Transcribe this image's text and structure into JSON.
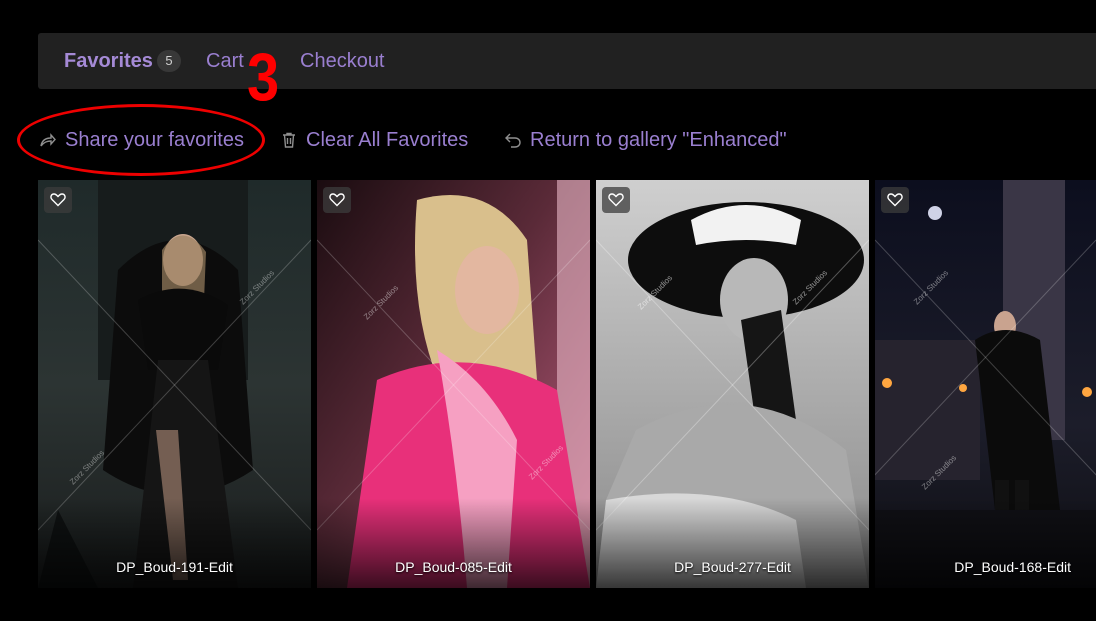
{
  "nav": {
    "tabs": [
      {
        "label": "Favorites",
        "badge": "5",
        "active": true
      },
      {
        "label": "Cart"
      },
      {
        "label": "Checkout"
      }
    ]
  },
  "annotation": {
    "step_number": "3",
    "color": "#ee0000"
  },
  "actions": {
    "share": {
      "label": "Share your favorites",
      "icon": "share-arrow-icon"
    },
    "clear": {
      "label": "Clear All Favorites",
      "icon": "trash-icon"
    },
    "return": {
      "label": "Return to gallery \"Enhanced\"",
      "icon": "undo-arrow-icon"
    }
  },
  "watermark": {
    "text": "Zorz Studios"
  },
  "photos": [
    {
      "caption": "DP_Boud-191-Edit",
      "icon": "heart-icon"
    },
    {
      "caption": "DP_Boud-085-Edit",
      "icon": "heart-icon"
    },
    {
      "caption": "DP_Boud-277-Edit",
      "icon": "heart-icon"
    },
    {
      "caption": "DP_Boud-168-Edit",
      "icon": "heart-icon"
    }
  ],
  "colors": {
    "accent": "#9a7fd0",
    "bar_bg": "#212121",
    "page_bg": "#000000"
  }
}
